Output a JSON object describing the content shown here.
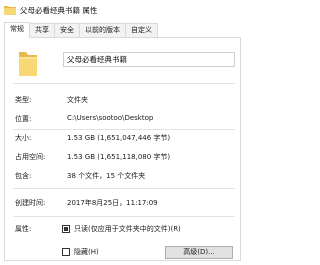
{
  "window": {
    "title": "父母必看经典书籍 属性"
  },
  "tabs": [
    {
      "label": "常规",
      "active": true
    },
    {
      "label": "共享"
    },
    {
      "label": "安全"
    },
    {
      "label": "以前的版本"
    },
    {
      "label": "自定义"
    }
  ],
  "general": {
    "folder_name": "父母必看经典书籍",
    "type": {
      "label": "类型:",
      "value": "文件夹"
    },
    "location": {
      "label": "位置:",
      "value": "C:\\Users\\sootoo\\Desktop"
    },
    "size": {
      "label": "大小:",
      "value": "1.53 GB (1,651,047,446 字节)"
    },
    "size_on_disk": {
      "label": "占用空间:",
      "value": "1.53 GB (1,651,118,080 字节)"
    },
    "contains": {
      "label": "包含:",
      "value": "38 个文件，15 个文件夹"
    },
    "created": {
      "label": "创建时间:",
      "value": "2017年8月25日，11:17:09"
    },
    "attributes": {
      "label": "属性:",
      "readonly": "只读(仅应用于文件夹中的文件)(R)",
      "hidden": "隐藏(H)",
      "advanced": "高级(D)..."
    }
  },
  "colors": {
    "folder": "#f8d775",
    "folder_dark": "#e8b84a"
  },
  "icons": {
    "title": "folder-icon",
    "big": "folder-icon"
  }
}
